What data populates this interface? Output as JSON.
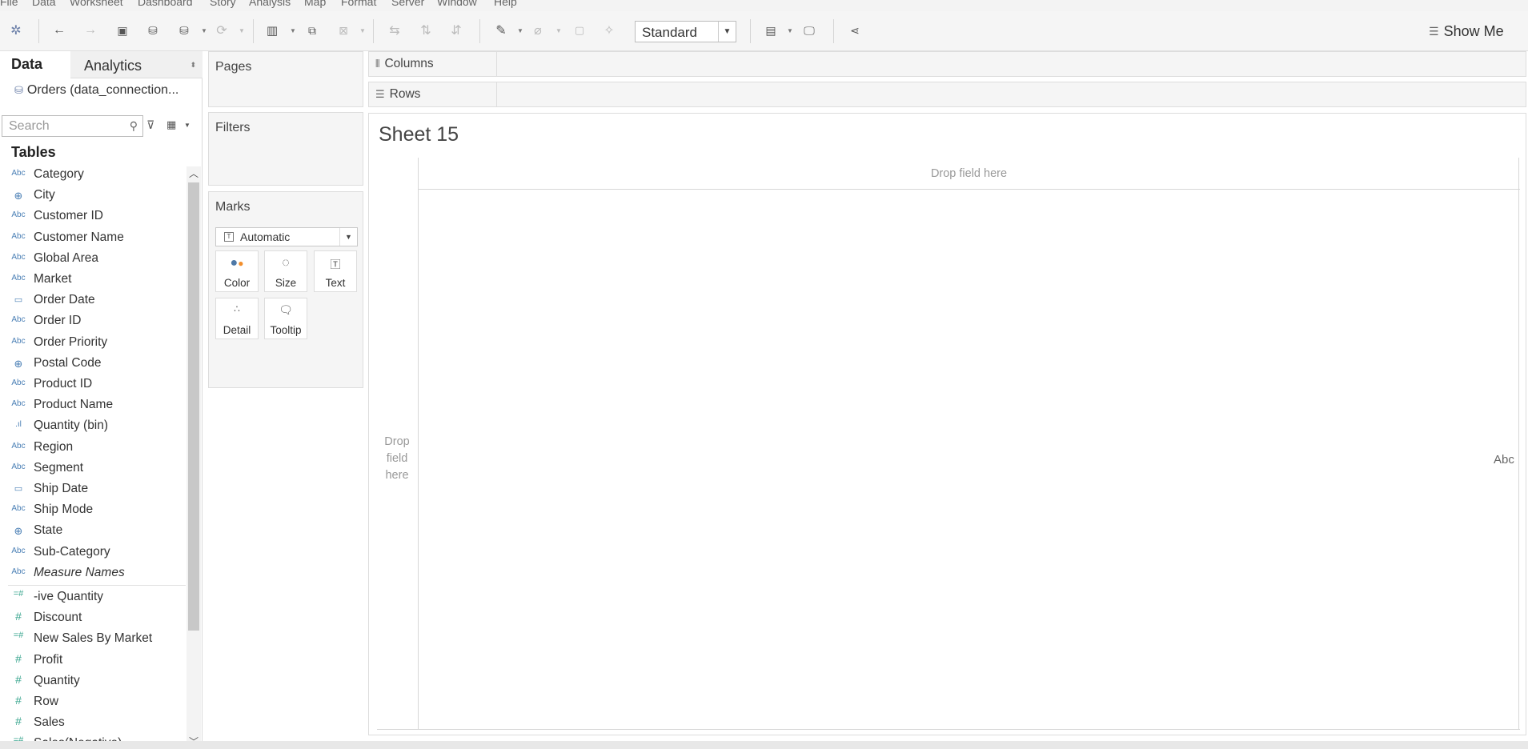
{
  "menu": [
    "File",
    "Data",
    "Worksheet",
    "Dashboard",
    "Story",
    "Analysis",
    "Map",
    "Format",
    "Server",
    "Window",
    "Help"
  ],
  "toolbar": {
    "fit_value": "Standard",
    "show_me_label": "Show Me"
  },
  "data_pane": {
    "tab_data": "Data",
    "tab_analytics": "Analytics",
    "connection": "Orders (data_connection...",
    "search_placeholder": "Search",
    "tables_heading": "Tables",
    "dimensions": [
      {
        "type": "Abc",
        "label": "Category"
      },
      {
        "type": "globe",
        "label": "City"
      },
      {
        "type": "Abc",
        "label": "Customer ID"
      },
      {
        "type": "Abc",
        "label": "Customer Name"
      },
      {
        "type": "Abc",
        "label": "Global Area"
      },
      {
        "type": "Abc",
        "label": "Market"
      },
      {
        "type": "calendar",
        "label": "Order Date"
      },
      {
        "type": "Abc",
        "label": "Order ID"
      },
      {
        "type": "Abc",
        "label": "Order Priority"
      },
      {
        "type": "globe",
        "label": "Postal Code"
      },
      {
        "type": "Abc",
        "label": "Product ID"
      },
      {
        "type": "Abc",
        "label": "Product Name"
      },
      {
        "type": "bin",
        "label": "Quantity (bin)"
      },
      {
        "type": "Abc",
        "label": "Region"
      },
      {
        "type": "Abc",
        "label": "Segment"
      },
      {
        "type": "calendar",
        "label": "Ship Date"
      },
      {
        "type": "Abc",
        "label": "Ship Mode"
      },
      {
        "type": "globe",
        "label": "State"
      },
      {
        "type": "Abc",
        "label": "Sub-Category"
      },
      {
        "type": "Abc",
        "label": "Measure Names",
        "italic": true
      }
    ],
    "measures": [
      {
        "type": "calc",
        "label": "-ive Quantity"
      },
      {
        "type": "hash",
        "label": "Discount"
      },
      {
        "type": "calc",
        "label": "New Sales By Market"
      },
      {
        "type": "hash",
        "label": "Profit"
      },
      {
        "type": "hash",
        "label": "Quantity"
      },
      {
        "type": "hash",
        "label": "Row"
      },
      {
        "type": "hash",
        "label": "Sales"
      },
      {
        "type": "calc",
        "label": "Sales(Negative)"
      }
    ]
  },
  "shelves": {
    "pages": "Pages",
    "filters": "Filters",
    "marks": "Marks",
    "mark_type": "Automatic",
    "mark_buttons": [
      "Color",
      "Size",
      "Text",
      "Detail",
      "Tooltip"
    ],
    "columns": "Columns",
    "rows": "Rows"
  },
  "canvas": {
    "sheet_title": "Sheet 15",
    "col_drop": "Drop field here",
    "row_drop_lines": [
      "Drop",
      "field",
      "here"
    ],
    "abc": "Abc"
  },
  "colors": {
    "dimension_icon": "#4a7fb5",
    "measure_icon": "#3aa68f"
  }
}
